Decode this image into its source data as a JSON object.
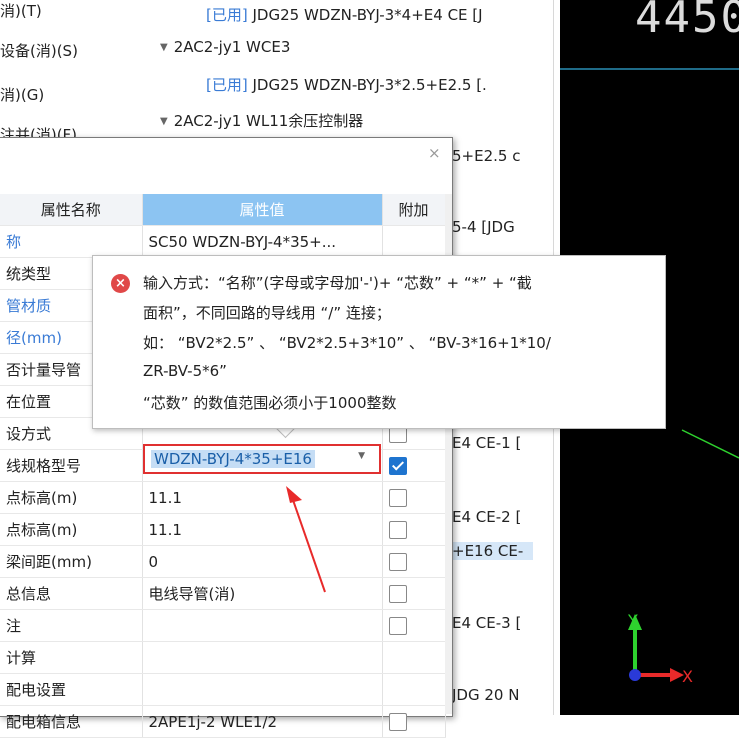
{
  "left_items": [
    "消)(T)",
    "设备(消)(S)",
    "消)(G)",
    "注并(消)(F)"
  ],
  "tree": {
    "rows": [
      {
        "prefix": "[已用]",
        "text": " JDG25 WDZN-BYJ-3*4+E4 CE [J"
      },
      {
        "text": "2AC2-jy1   WCE3"
      },
      {
        "prefix": "[已用]",
        "text": " JDG25 WDZN-BYJ-3*2.5+E2.5 [."
      },
      {
        "text": "2AC2-jy1   WL11余压控制器"
      }
    ],
    "fragments": [
      "5+E2.5 c",
      "5-4 [JDG",
      "E4 CE-1 [",
      "E4 CE-2 [",
      "+E16 CE-",
      "E4 CE-3 [",
      "JDG 20 N"
    ]
  },
  "cad": {
    "number": "4450"
  },
  "dialog": {
    "close": "×",
    "headers": {
      "name": "属性名称",
      "value": "属性值",
      "extra": "附加"
    },
    "rows": [
      {
        "name": "称",
        "value": "SC50 WDZN-BYJ-4*35+...",
        "blue": true,
        "check": null
      },
      {
        "name": "统类型",
        "value": "",
        "blue": false,
        "check": null
      },
      {
        "name": "管材质",
        "value": "",
        "blue": true,
        "check": null
      },
      {
        "name": "径(mm)",
        "value": "",
        "blue": true,
        "check": null
      },
      {
        "name": "否计量导管",
        "value": "",
        "blue": false,
        "check": null
      },
      {
        "name": "在位置",
        "value": "",
        "blue": false,
        "check": null
      },
      {
        "name": "设方式",
        "value": "",
        "blue": false,
        "check": "off"
      },
      {
        "name": "线规格型号",
        "value": "",
        "blue": false,
        "check": "on"
      },
      {
        "name": "点标高(m)",
        "value": "11.1",
        "blue": false,
        "check": "off"
      },
      {
        "name": "点标高(m)",
        "value": "11.1",
        "blue": false,
        "check": "off"
      },
      {
        "name": "梁间距(mm)",
        "value": "0",
        "blue": false,
        "check": "off"
      },
      {
        "name": "总信息",
        "value": "电线导管(消)",
        "blue": false,
        "check": "off"
      },
      {
        "name": "注",
        "value": "",
        "blue": false,
        "check": "off"
      },
      {
        "name": "计算",
        "value": "",
        "blue": false,
        "check": null
      },
      {
        "name": "配电设置",
        "value": "",
        "blue": false,
        "check": null
      },
      {
        "name": "配电箱信息",
        "value": "2APE1j-2  WLE1/2",
        "blue": false,
        "check": "off"
      }
    ],
    "combo_value": "WDZN-BYJ-4*35+E16"
  },
  "tooltip": {
    "icon": "×",
    "lines": [
      "输入方式：“名称”(字母或字母加'-')+ “芯数” + “*” + “截",
      "面积”，不同回路的导线用 “/” 连接；",
      "如： “BV2*2.5” 、 “BV2*2.5+3*10” 、 “BV-3*16+1*10/",
      "ZR-BV-5*6”",
      " “芯数” 的数值范围必须小于1000整数"
    ]
  },
  "axes": {
    "y": "Y",
    "x": "X"
  },
  "colors": {
    "accent": "#3a7bd5",
    "error": "#e03030",
    "header_value": "#8cc4f2",
    "cad_bg": "#000000"
  }
}
